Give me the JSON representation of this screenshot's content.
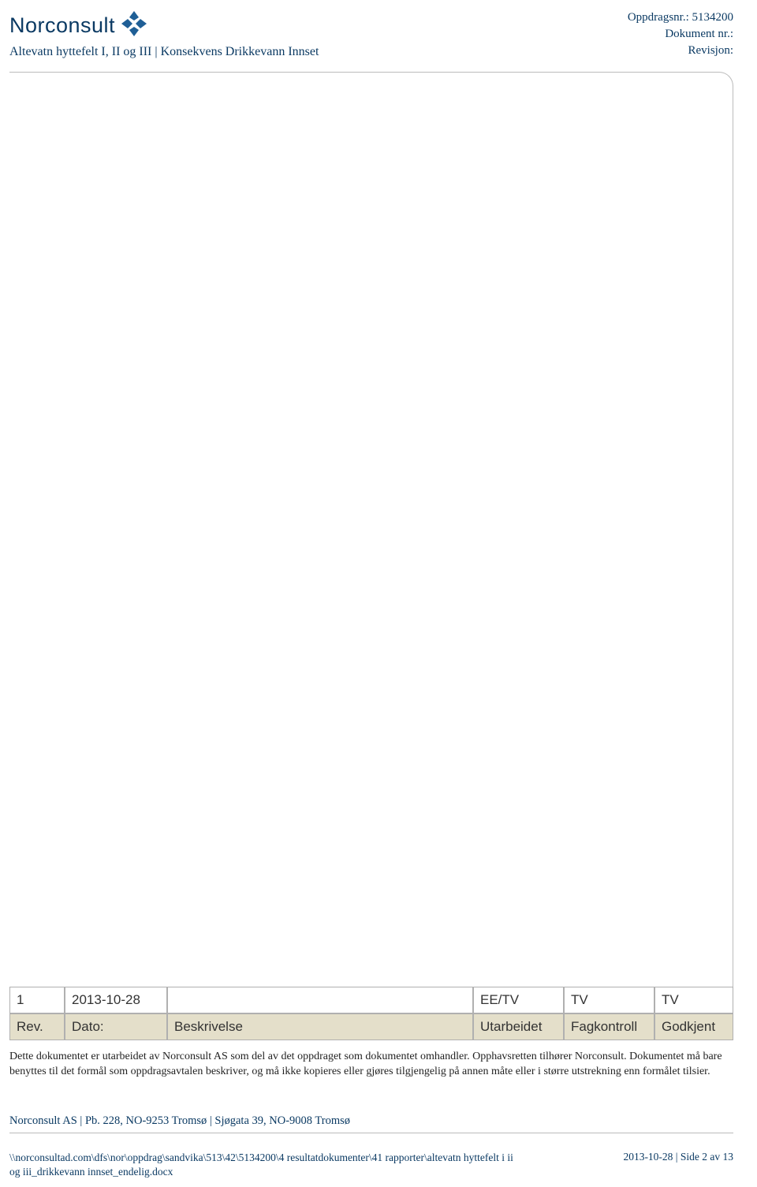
{
  "header": {
    "logo_text": "Norconsult",
    "subtitle": "Altevatn hyttefelt I, II og III | Konsekvens Drikkevann Innset",
    "meta": {
      "oppdrag_label": "Oppdragsnr.: ",
      "oppdrag_value": "5134200",
      "dokument_label": "Dokument nr.: ",
      "revisjon_label": "Revisjon: "
    }
  },
  "revision_table": {
    "data_row": {
      "rev": "1",
      "dato": "2013-10-28",
      "beskrivelse": "",
      "utarbeidet": "EE/TV",
      "fagkontroll": "TV",
      "godkjent": "TV"
    },
    "headers": {
      "rev": "Rev.",
      "dato": "Dato:",
      "beskrivelse": "Beskrivelse",
      "utarbeidet": "Utarbeidet",
      "fagkontroll": "Fagkontroll",
      "godkjent": "Godkjent"
    }
  },
  "disclaimer": "Dette dokumentet er utarbeidet av Norconsult AS som del av det oppdraget som dokumentet omhandler. Opphavsretten tilhører Norconsult. Dokumentet må bare benyttes til det formål som oppdragsavtalen beskriver, og må ikke kopieres eller gjøres tilgjengelig på annen måte eller i større utstrekning enn formålet tilsier.",
  "company_info": "Norconsult AS | Pb. 228, NO-9253 Tromsø | Sjøgata 39, NO-9008 Tromsø",
  "footer": {
    "path": "\\\\norconsultad.com\\dfs\\nor\\oppdrag\\sandvika\\513\\42\\5134200\\4 resultatdokumenter\\41 rapporter\\altevatn hyttefelt i ii og iii_drikkevann innset_endelig.docx",
    "page_info": "2013-10-28 | Side 2 av 13"
  }
}
